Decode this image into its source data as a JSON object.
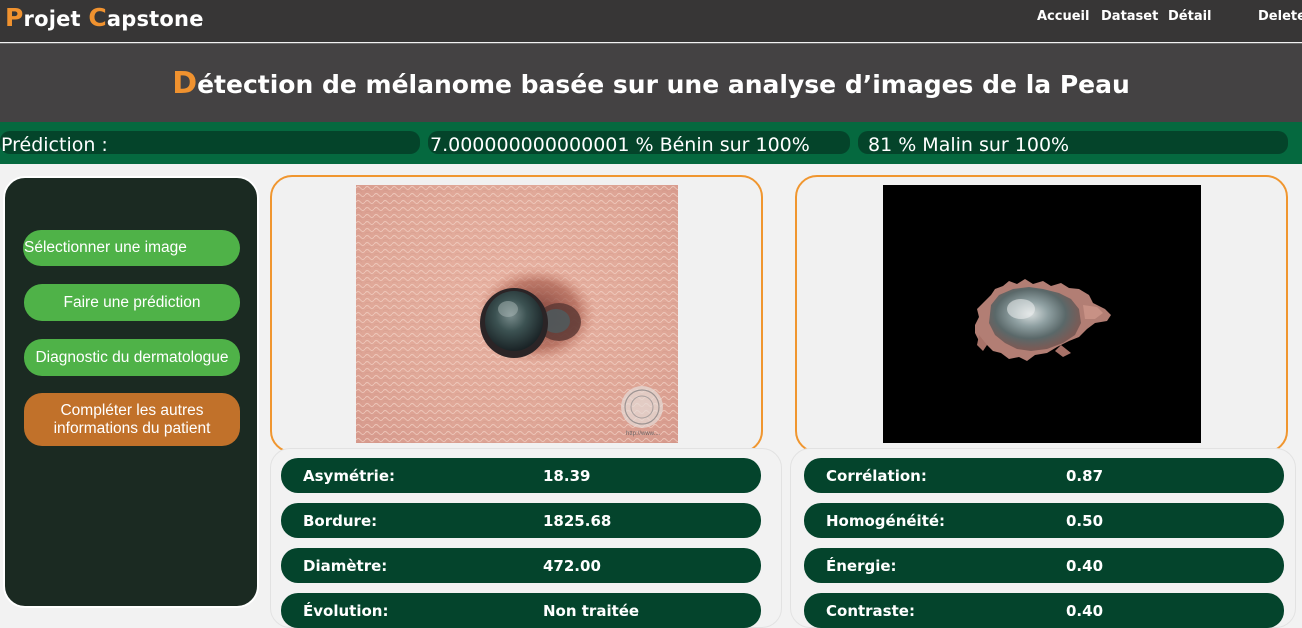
{
  "brand": {
    "first_initial": "P",
    "first_rest": "rojet ",
    "second_initial": "C",
    "second_rest": "apstone"
  },
  "nav": {
    "home": "Accueil",
    "dataset": "Dataset",
    "detail": "Détail",
    "delete": "Delete"
  },
  "banner": {
    "title_initial": "D",
    "title_rest": "étection de mélanome basée sur une analyse d’images de la Peau"
  },
  "prediction": {
    "label": "Prédiction :",
    "benign": "7.000000000000001 % Bénin sur 100%",
    "malignant": "81 % Malin sur 100%"
  },
  "actions": {
    "select_image": "Sélectionner une image",
    "predict": "Faire une prédiction",
    "dermatologist": "Diagnostic du dermatologue",
    "complete_info": "Compléter les autres informations du patient"
  },
  "images": {
    "watermark": "http://www...."
  },
  "stats_left": [
    {
      "label": "Asymétrie:",
      "value": "18.39"
    },
    {
      "label": "Bordure:",
      "value": "1825.68"
    },
    {
      "label": "Diamètre:",
      "value": "472.00"
    },
    {
      "label": "Évolution:",
      "value": "Non traitée"
    }
  ],
  "stats_right": [
    {
      "label": "Corrélation:",
      "value": "0.87"
    },
    {
      "label": "Homogénéité:",
      "value": "0.50"
    },
    {
      "label": "Énergie:",
      "value": "0.40"
    },
    {
      "label": "Contraste:",
      "value": "0.40"
    }
  ],
  "colors": {
    "accent": "#f0922f",
    "dark_green": "#04442c",
    "green": "#05693f",
    "button_green": "#4fb248",
    "button_orange": "#c1712a"
  }
}
